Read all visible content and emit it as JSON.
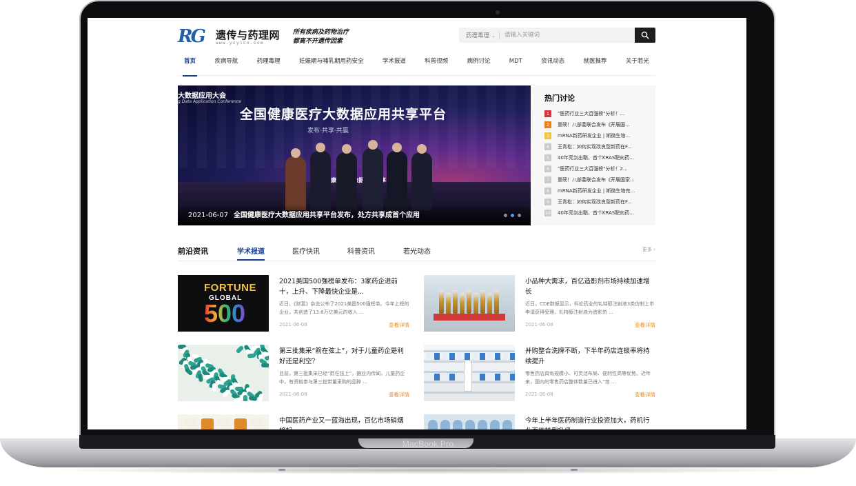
{
  "device": {
    "label": "MacBook Pro"
  },
  "site": {
    "logo_mark": "RG",
    "name": "遗传与药理网",
    "url": "www.ycylcn.com",
    "slogan_line1": "所有疾病及药物治疗",
    "slogan_line2": "都离不开遗传因素"
  },
  "search": {
    "category": "药理毒理",
    "placeholder": "请输入关键词",
    "value": ""
  },
  "nav": {
    "items": [
      {
        "label": "首页",
        "active": true
      },
      {
        "label": "疾病导航",
        "active": false
      },
      {
        "label": "药理毒理",
        "active": false
      },
      {
        "label": "妊娠期与哺乳期用药安全",
        "active": false
      },
      {
        "label": "学术报道",
        "active": false
      },
      {
        "label": "科普视频",
        "active": false
      },
      {
        "label": "病例讨论",
        "active": false
      },
      {
        "label": "MDT",
        "active": false
      },
      {
        "label": "资讯动态",
        "active": false
      },
      {
        "label": "就医推荐",
        "active": false
      },
      {
        "label": "关于若光",
        "active": false
      }
    ]
  },
  "banner": {
    "backdrop_title": "大数据应用大会",
    "backdrop_subtitle": "g Data Application Conference",
    "headline": "全国健康医疗大数据应用共享平台",
    "subline": "发布·共享·共赢",
    "screen_text": "康医疗大数据应用共享",
    "date": "2021-06-07",
    "caption": "全国健康医疗大数据应用共享平台发布，处方共享成首个应用",
    "slides": 3,
    "active_slide": 2
  },
  "hot": {
    "title": "热门讨论",
    "items": [
      {
        "rank": "1",
        "text": "\"医药行业三大百强榜\"分析！..."
      },
      {
        "rank": "2",
        "text": "重磅！八部委联合发布《开展国..."
      },
      {
        "rank": "3",
        "text": "mRNA新药研发企业 | 斯微生物..."
      },
      {
        "rank": "4",
        "text": "王青松：如何实现改良型新药在F..."
      },
      {
        "rank": "5",
        "text": "40年亮剑出鞘，首个KRAS靶向药..."
      },
      {
        "rank": "6",
        "text": "\"医药行业三大百强榜\"分析！2..."
      },
      {
        "rank": "7",
        "text": "重磅！八部委联合发布《开展国家..."
      },
      {
        "rank": "8",
        "text": "mRNA新药研发企业 | 斯微生物完..."
      },
      {
        "rank": "9",
        "text": "王青松：如何实现改良型新药在F..."
      },
      {
        "rank": "10",
        "text": "40年亮剑出鞘，首个KRAS靶向药..."
      }
    ]
  },
  "section": {
    "label": "前沿资讯",
    "tabs": [
      "学术报道",
      "医疗快讯",
      "科普资讯",
      "若光动态"
    ],
    "active_tab": 0,
    "more": "更多 ›"
  },
  "articles": [
    {
      "thumb": {
        "type": "fortune",
        "line1": "FORTUNE",
        "line2": "GLOBAL",
        "line3": "500"
      },
      "title": "2021美国500强榜单发布：3家药企进前十，上升、下降最快企业是...",
      "excerpt": "近日，《财富》杂志公布了2021美国500强榜单。今年上榜的企业，共创造了13.8万亿美元的收入 ...",
      "date": "2021-06-08",
      "link": "查看详情"
    },
    {
      "thumb": {
        "type": "vials"
      },
      "title": "小品种大需求，百亿造影剂市场持续加速增长",
      "excerpt": "近日，CDE数据显示，科伦药业的钆特醇注射液3类仿制上市申请获得受理。钆特醇注射液为造影剂 ...",
      "date": "2021-06-08",
      "link": "查看详情"
    },
    {
      "thumb": {
        "type": "pills"
      },
      "title": "第三批集采“箭在弦上”，对于儿童药企是利好还是利空？",
      "excerpt": "目前，第三批集采已经“箭在弦上”，据业内传闻，儿童药企中，有资格参与第三批带量采购的品种 ...",
      "date": "2021-06-08",
      "link": "查看详情"
    },
    {
      "thumb": {
        "type": "pharmacy"
      },
      "title": "并购整合洗牌不断，下半年药店连锁率将持续提升",
      "excerpt": "零售药店具有规模小、可灵活布局、便利性高等优势。近年来，国内的零售药店整体数量已进入“饱 ...",
      "date": "2021-06-08",
      "link": "查看详情"
    },
    {
      "thumb": {
        "type": "bottles"
      },
      "title": "中国医药产业又一蓝海出现，百亿市场硝烟将起",
      "excerpt": "",
      "date": "",
      "link": ""
    },
    {
      "thumb": {
        "type": "lab"
      },
      "title": "今年上半年医药制造行业投资加大，药机行业面临转型升级",
      "excerpt": "",
      "date": "",
      "link": ""
    }
  ],
  "colors": {
    "accent": "#1a3f8c",
    "link_orange": "#e98a1d",
    "rank1": "#d8313c",
    "rank2": "#ef7d1a",
    "rank3": "#f2c43a"
  }
}
